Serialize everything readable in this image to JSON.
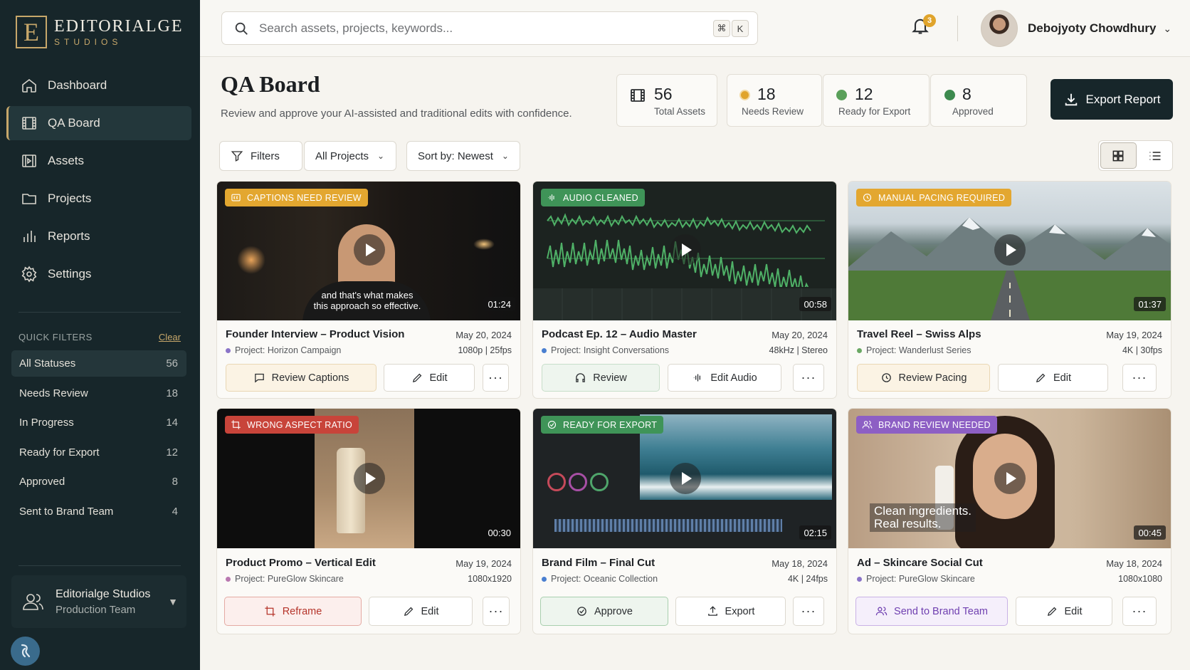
{
  "brand": {
    "mark": "E",
    "name": "EDITORIALGE",
    "sub": "STUDIOS"
  },
  "nav": [
    {
      "label": "Dashboard",
      "icon": "home-icon"
    },
    {
      "label": "QA Board",
      "icon": "film-icon",
      "active": true
    },
    {
      "label": "Assets",
      "icon": "film-strip-icon"
    },
    {
      "label": "Projects",
      "icon": "folder-icon"
    },
    {
      "label": "Reports",
      "icon": "bar-chart-icon"
    },
    {
      "label": "Settings",
      "icon": "gear-icon"
    }
  ],
  "quick_filters": {
    "title": "QUICK FILTERS",
    "clear": "Clear",
    "items": [
      {
        "label": "All Statuses",
        "count": "56"
      },
      {
        "label": "Needs Review",
        "count": "18"
      },
      {
        "label": "In Progress",
        "count": "14"
      },
      {
        "label": "Ready for Export",
        "count": "12"
      },
      {
        "label": "Approved",
        "count": "8"
      },
      {
        "label": "Sent to Brand Team",
        "count": "4"
      }
    ]
  },
  "team": {
    "name": "Editorialge Studios",
    "sub": "Production Team"
  },
  "search": {
    "placeholder": "Search assets, projects, keywords...",
    "kbd1": "⌘",
    "kbd2": "K"
  },
  "notifications": {
    "count": "3"
  },
  "user": {
    "name": "Debojyoty Chowdhury"
  },
  "header": {
    "title": "QA Board",
    "subtitle": "Review and approve your AI-assisted and traditional edits with confidence."
  },
  "stats": [
    {
      "value": "56",
      "label": "Total Assets"
    },
    {
      "value": "18",
      "label": "Needs Review",
      "color": "#e0a42b"
    },
    {
      "value": "12",
      "label": "Ready for Export",
      "color": "#5aa05a"
    },
    {
      "value": "8",
      "label": "Approved",
      "color": "#3d8a4e"
    }
  ],
  "export_label": "Export Report",
  "toolbar": {
    "filters": "Filters",
    "projects": "All Projects",
    "sort": "Sort by: Newest"
  },
  "cards": [
    {
      "badge": "CAPTIONS NEED REVIEW",
      "title": "Founder Interview – Product Vision",
      "date": "May 20, 2024",
      "project": "Project: Horizon Campaign",
      "meta": "1080p | 25fps",
      "duration": "01:24",
      "overlay": "and that's what makes\nthis approach so effective.",
      "primary": "Review Captions",
      "secondary": "Edit"
    },
    {
      "badge": "AUDIO CLEANED",
      "title": "Podcast Ep. 12 – Audio Master",
      "date": "May 20, 2024",
      "project": "Project: Insight Conversations",
      "meta": "48kHz | Stereo",
      "duration": "00:58",
      "primary": "Review",
      "secondary": "Edit Audio"
    },
    {
      "badge": "MANUAL PACING REQUIRED",
      "title": "Travel Reel – Swiss Alps",
      "date": "May 19, 2024",
      "project": "Project: Wanderlust Series",
      "meta": "4K | 30fps",
      "duration": "01:37",
      "primary": "Review Pacing",
      "secondary": "Edit"
    },
    {
      "badge": "WRONG ASPECT RATIO",
      "title": "Product Promo – Vertical Edit",
      "date": "May 19, 2024",
      "project": "Project: PureGlow Skincare",
      "meta": "1080x1920",
      "duration": "00:30",
      "primary": "Reframe",
      "secondary": "Edit"
    },
    {
      "badge": "READY FOR EXPORT",
      "title": "Brand Film – Final Cut",
      "date": "May 18, 2024",
      "project": "Project: Oceanic Collection",
      "meta": "4K | 24fps",
      "duration": "02:15",
      "primary": "Approve",
      "secondary": "Export"
    },
    {
      "badge": "BRAND REVIEW NEEDED",
      "title": "Ad – Skincare Social Cut",
      "date": "May 18, 2024",
      "project": "Project: PureGlow Skincare",
      "meta": "1080x1080",
      "duration": "00:45",
      "overlay": "Clean ingredients.\nReal results.",
      "primary": "Send to Brand Team",
      "secondary": "Edit"
    }
  ],
  "more_label": "···"
}
